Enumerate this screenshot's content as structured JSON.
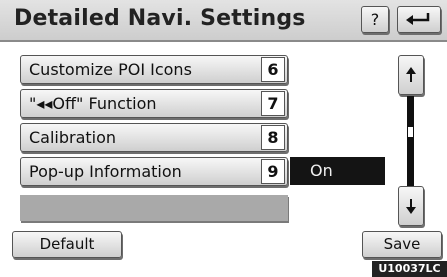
{
  "header": {
    "title": "Detailed Navi. Settings",
    "help_label": "?",
    "back_icon": "return-arrow-icon"
  },
  "menu": {
    "items": [
      {
        "label": "Customize POI Icons",
        "number": "6"
      },
      {
        "label": "\"◂◂Off\" Function",
        "number": "7"
      },
      {
        "label": "Calibration",
        "number": "8"
      },
      {
        "label": "Pop-up Information",
        "number": "9"
      }
    ],
    "popup_status": "On"
  },
  "scroll": {
    "up_icon": "page-up-icon",
    "down_icon": "page-down-icon"
  },
  "footer": {
    "default_label": "Default",
    "save_label": "Save",
    "image_code": "U10037LC"
  }
}
